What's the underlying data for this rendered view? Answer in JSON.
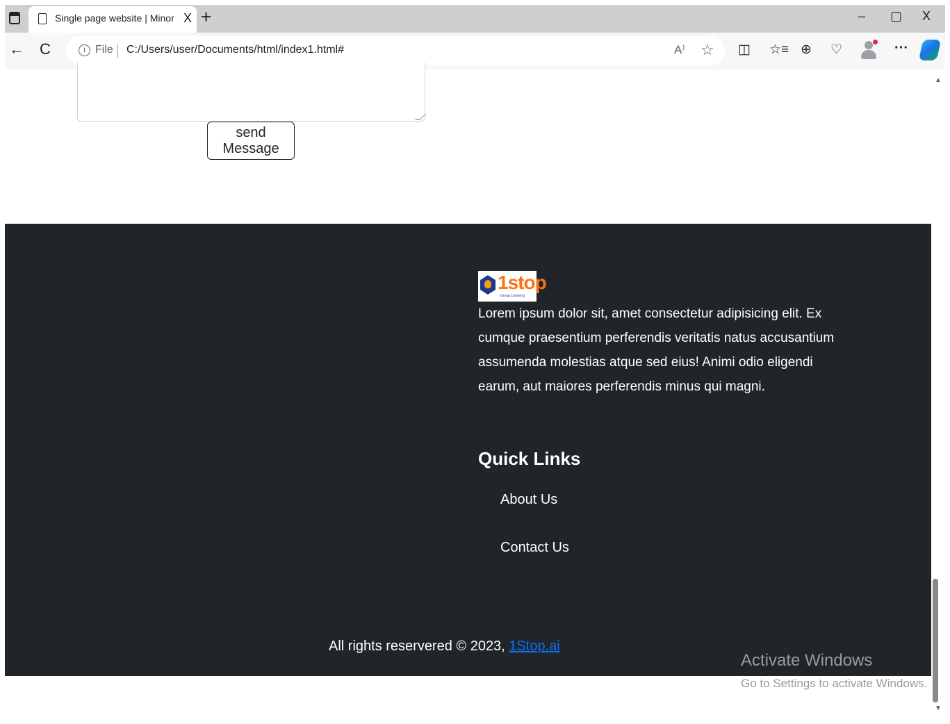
{
  "browser": {
    "tab_title": "Single page website | Minor proj",
    "tab_close": "X",
    "new_tab": "+",
    "window_controls": {
      "minimize": "–",
      "maximize": "▢",
      "close": "X"
    },
    "nav": {
      "back": "←",
      "reload": "C"
    },
    "address": {
      "info": "i",
      "scheme_label": "File",
      "url": "C:/Users/user/Documents/html/index1.html#"
    },
    "toolbar_icons": {
      "read_aloud": "A⁾",
      "favorite": "☆",
      "split_screen": "◫",
      "favorites_list": "☆≡",
      "collections": "⊕",
      "browser_essentials": "♡",
      "more": "···"
    }
  },
  "contact_form": {
    "message_value": "",
    "send_label": "send Message"
  },
  "footer": {
    "logo": {
      "word": "1stop",
      "tagline": "Group Learning"
    },
    "about": "Lorem ipsum dolor sit, amet consectetur adipisicing elit. Ex cumque praesentium perferendis veritatis natus accusantium assumenda molestias atque sed eius! Animi odio eligendi earum, aut maiores perferendis minus qui magni.",
    "quick_links_title": "Quick Links",
    "quick_links": [
      {
        "label": "About Us"
      },
      {
        "label": "Contact Us"
      }
    ],
    "copyright_text": "All rights reservered © 2023,",
    "copyright_link": "1Stop.ai"
  },
  "scrollbar": {
    "up": "▲",
    "down": "▼"
  },
  "watermark": {
    "title": "Activate Windows",
    "subtitle": "Go to Settings to activate Windows."
  },
  "colors": {
    "footer_bg": "#212529",
    "link": "#0d6efd",
    "logo_orange": "#f97316",
    "logo_navy": "#1f3a8a"
  }
}
